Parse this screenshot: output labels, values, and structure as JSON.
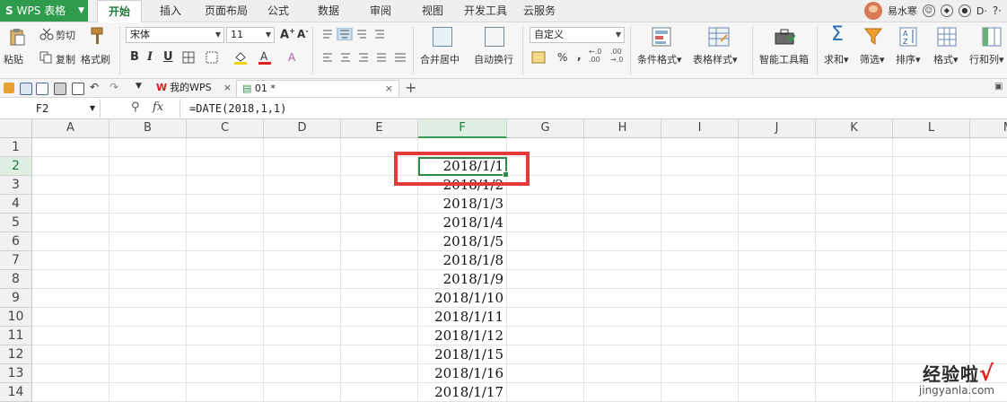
{
  "app": {
    "name": "WPS 表格",
    "logo": "S"
  },
  "menu": {
    "tabs": [
      {
        "label": "开始",
        "active": true
      },
      {
        "label": "插入"
      },
      {
        "label": "页面布局"
      },
      {
        "label": "公式"
      },
      {
        "label": "数据"
      },
      {
        "label": "审阅"
      },
      {
        "label": "视图"
      },
      {
        "label": "开发工具"
      },
      {
        "label": "云服务"
      }
    ],
    "user_name": "易水寒"
  },
  "ribbon": {
    "paste": "粘贴",
    "cut": "剪切",
    "copy": "复制",
    "format_painter": "格式刷",
    "font_name": "宋体",
    "font_size": "11",
    "bold": "B",
    "italic": "I",
    "underline": "U",
    "number_format": "自定义",
    "merge_center": "合并居中",
    "wrap_text": "自动换行",
    "conditional_format": "条件格式",
    "table_style": "表格样式",
    "smart_toolbox": "智能工具箱",
    "sum": "求和",
    "filter": "筛选",
    "sort": "排序",
    "format": "格式",
    "rows_cols": "行和列",
    "percent": "%",
    "comma": ","
  },
  "doc_tabs": {
    "my_wps": "我的WPS",
    "file": "01 *"
  },
  "formula_bar": {
    "cell_ref": "F2",
    "fx": "fx",
    "formula": "=DATE(2018,1,1)"
  },
  "grid": {
    "columns": [
      "A",
      "B",
      "C",
      "D",
      "E",
      "F",
      "G",
      "H",
      "I",
      "J",
      "K",
      "L",
      "M"
    ],
    "rows": [
      "1",
      "2",
      "3",
      "4",
      "5",
      "6",
      "7",
      "8",
      "9",
      "10",
      "11",
      "12",
      "13",
      "14"
    ],
    "f_values": [
      "",
      "2018/1/1",
      "2018/1/2",
      "2018/1/3",
      "2018/1/4",
      "2018/1/5",
      "2018/1/8",
      "2018/1/9",
      "2018/1/10",
      "2018/1/11",
      "2018/1/12",
      "2018/1/15",
      "2018/1/16",
      "2018/1/17"
    ],
    "selected_cell": "F2"
  },
  "watermark": {
    "main": "经验啦",
    "check": "√",
    "url": "jingyanla.com"
  }
}
